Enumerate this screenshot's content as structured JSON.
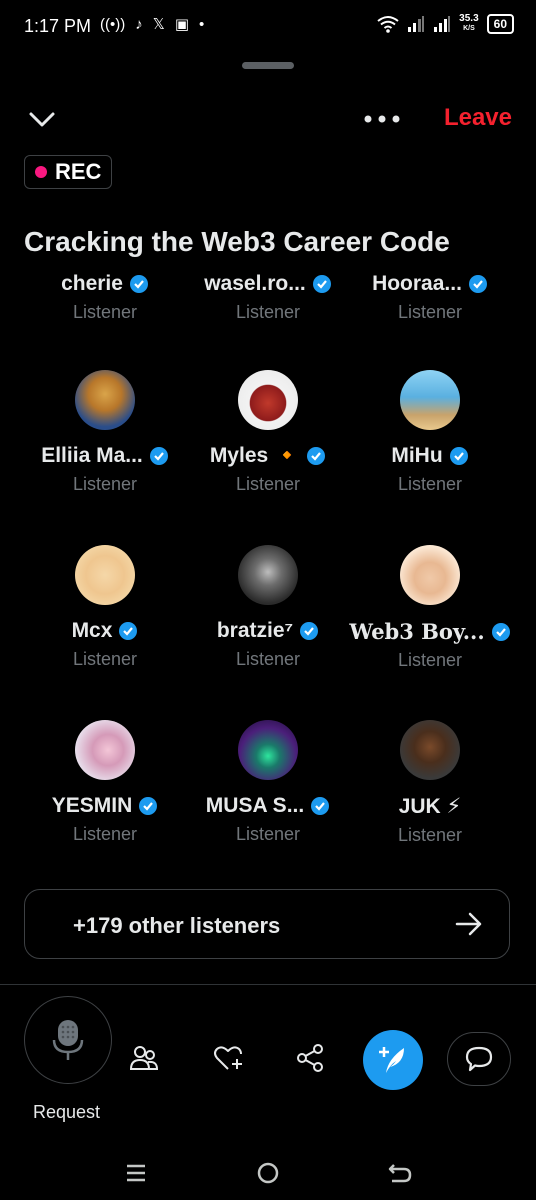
{
  "status_bar": {
    "time": "1:17 PM",
    "left_icons": [
      "radio-icon",
      "tiktok-icon",
      "x-icon",
      "gallery-icon",
      "dot-icon"
    ],
    "speed_value": "35.3",
    "speed_unit": "K/S",
    "battery": "60"
  },
  "header": {
    "leave_label": "Leave",
    "rec_label": "REC",
    "space_title": "Cracking the Web3 Career Code"
  },
  "participants": [
    {
      "name": "cherie",
      "role": "Listener",
      "verified": true
    },
    {
      "name": "wasel.ro...",
      "role": "Listener",
      "verified": true
    },
    {
      "name": "Hooraa...",
      "role": "Listener",
      "verified": true
    },
    {
      "name": "Elliia Ma...",
      "role": "Listener",
      "verified": true
    },
    {
      "name": "Myles 🔸",
      "role": "Listener",
      "verified": true
    },
    {
      "name": "MiHu",
      "role": "Listener",
      "verified": true
    },
    {
      "name": "Mcx",
      "role": "Listener",
      "verified": true
    },
    {
      "name": "bratzie⁷",
      "role": "Listener",
      "verified": true
    },
    {
      "name": "Web3 Boy...",
      "role": "Listener",
      "verified": true
    },
    {
      "name": "YESMIN",
      "role": "Listener",
      "verified": true
    },
    {
      "name": "MUSA S...",
      "role": "Listener",
      "verified": true
    },
    {
      "name": "JUK ⚡",
      "role": "Listener",
      "verified": false
    }
  ],
  "listeners_button": {
    "label": "+179 other listeners"
  },
  "controls": {
    "request_label": "Request"
  },
  "colors": {
    "accent": "#1d9bf0",
    "leave": "#f4212e",
    "rec_dot": "#f91880",
    "secondary_text": "#71767b"
  }
}
